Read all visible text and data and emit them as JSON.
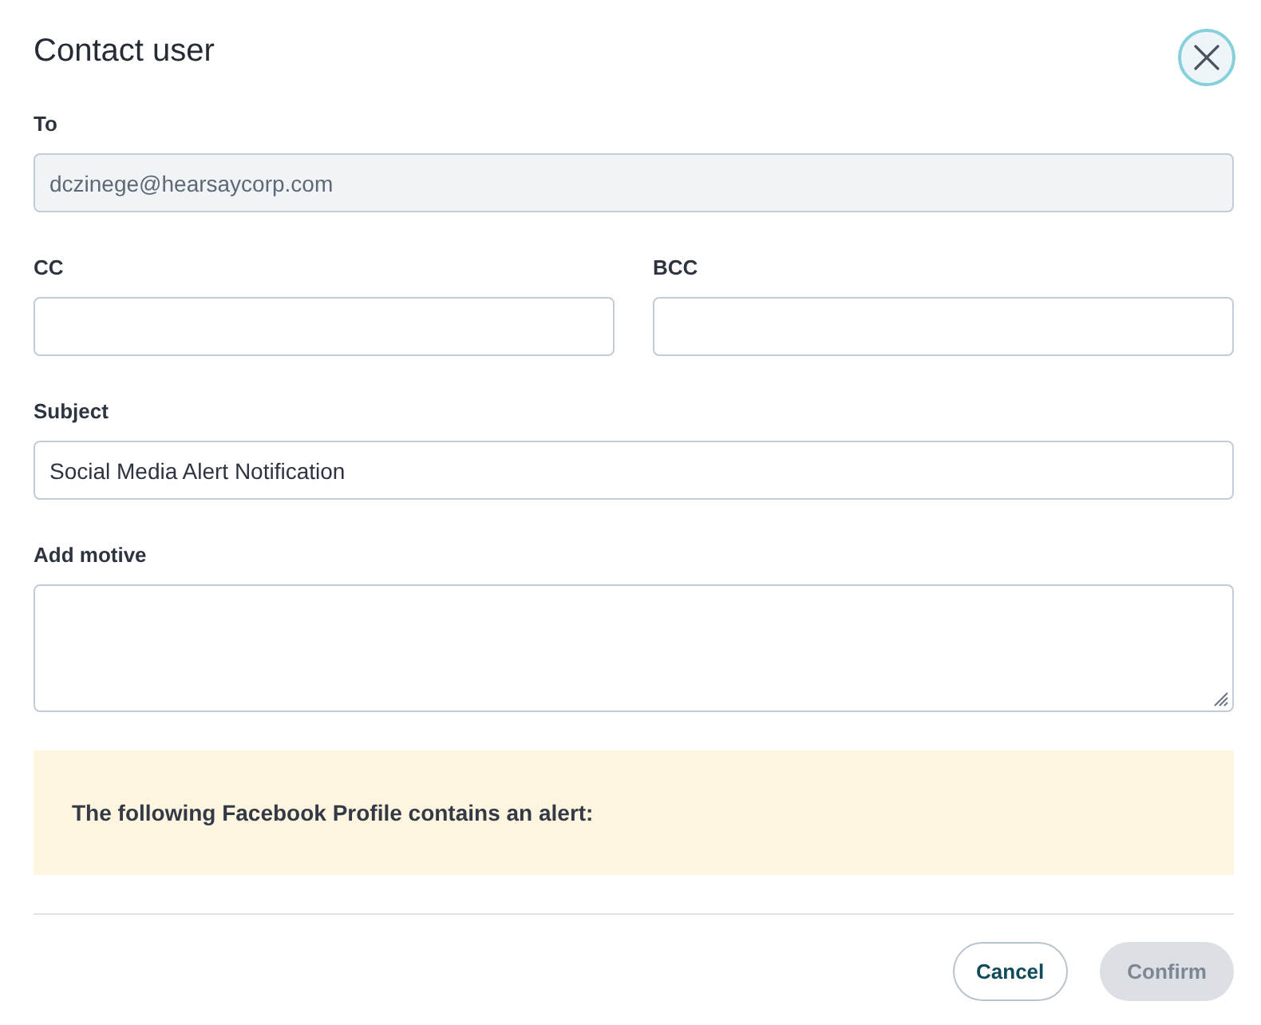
{
  "dialog": {
    "title": "Contact user"
  },
  "form_rows": [
    {
      "fields": [
        {
          "kind": "input",
          "label": "To",
          "value": "dczinege@hearsaycorp.com",
          "disabled": true
        }
      ]
    },
    {
      "fields": [
        {
          "kind": "input",
          "label": "CC",
          "disabled": false
        },
        {
          "kind": "input",
          "label": "BCC",
          "disabled": false
        }
      ]
    },
    {
      "fields": [
        {
          "kind": "input",
          "label": "Subject",
          "value": "Social Media Alert Notification",
          "disabled": false
        }
      ]
    },
    {
      "fields": [
        {
          "kind": "textarea",
          "label": "Add motive",
          "disabled": false
        }
      ]
    }
  ],
  "alert": {
    "text": "The following Facebook Profile contains an alert:"
  },
  "buttons": [
    {
      "kind": "secondary",
      "label": "Cancel",
      "disabled": false
    },
    {
      "kind": "primary",
      "label": "Confirm",
      "disabled": true
    }
  ]
}
